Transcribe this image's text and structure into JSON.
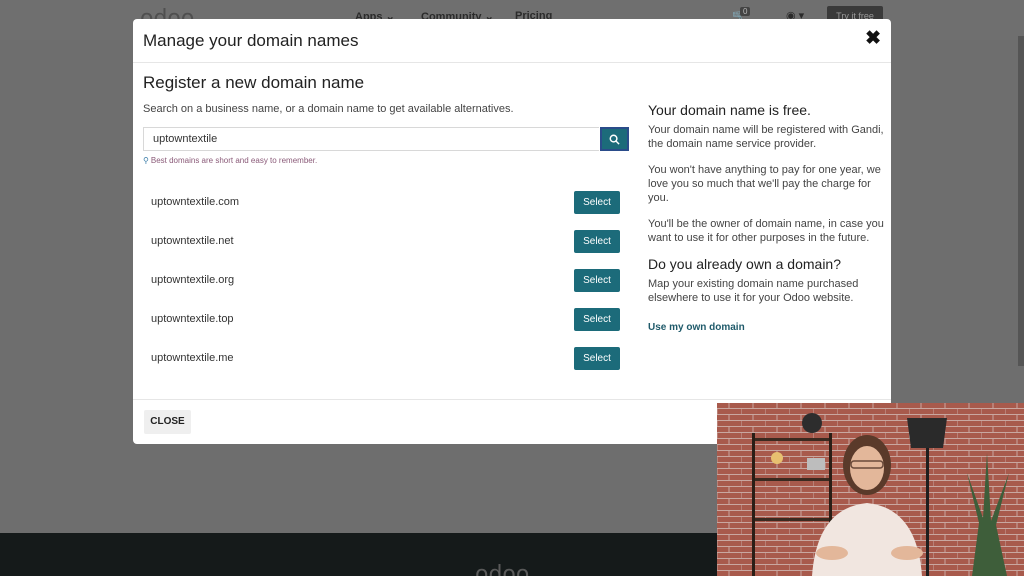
{
  "background": {
    "logo": "odoo",
    "menu": [
      "Apps",
      "Community",
      "Pricing"
    ],
    "cart_count": "0",
    "try_button": "Try it free",
    "footer_logo": "odoo"
  },
  "modal": {
    "title": "Manage your domain names",
    "section_title": "Register a new domain name",
    "search_description": "Search on a business name, or a domain name to get available alternatives.",
    "search_value": "uptowntextile",
    "hint": "Best domains are short and easy to remember.",
    "select_label": "Select",
    "domains": [
      "uptowntextile.com",
      "uptowntextile.net",
      "uptowntextile.org",
      "uptowntextile.top",
      "uptowntextile.me"
    ],
    "right": {
      "free_title": "Your domain name is free.",
      "free_p1": "Your domain name will be registered with Gandi, the domain name service provider.",
      "free_p2": "You won't have anything to pay for one year, we love you so much that we'll pay the charge for you.",
      "free_p3": "You'll be the owner of domain name, in case you want to use it for other purposes in the future.",
      "own_title": "Do you already own a domain?",
      "own_p": "Map your existing domain name purchased elsewhere to use it for your Odoo website.",
      "own_link": "Use my own domain"
    },
    "close_label": "CLOSE"
  },
  "colors": {
    "accent": "#1c6b7a",
    "overlay": "#6e6e6e"
  }
}
